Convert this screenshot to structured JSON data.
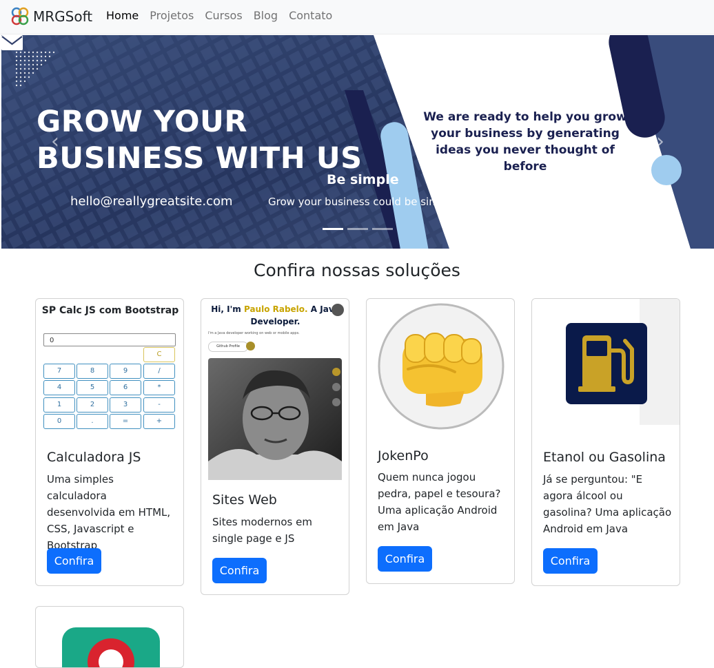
{
  "navbar": {
    "brand": "MRGSoft",
    "links": [
      {
        "label": "Home",
        "active": true
      },
      {
        "label": "Projetos",
        "active": false
      },
      {
        "label": "Cursos",
        "active": false
      },
      {
        "label": "Blog",
        "active": false
      },
      {
        "label": "Contato",
        "active": false
      }
    ]
  },
  "hero": {
    "title_line1": "GROW YOUR",
    "title_line2": "BUSINESS WITH US",
    "email": "hello@reallygreatsite.com",
    "right_text": "We are ready to help you grow your business by generating ideas you never thought of before",
    "caption_title": "Be simple",
    "caption_text": "Grow your business could be simple",
    "indicators": 3,
    "active_indicator": 1,
    "prev_icon": "chevron-left-icon",
    "next_icon": "chevron-right-icon",
    "colors": {
      "navy": "#1a2050",
      "light_blue": "#9fccef"
    }
  },
  "section": {
    "title": "Confira nossas soluções"
  },
  "cards": [
    {
      "title": "Calculadora JS",
      "text": "Uma simples calculadora desenvolvida em HTML, CSS, Javascript e Bootstrap",
      "button": "Confira",
      "preview": {
        "title": "SP Calc JS com Bootstrap",
        "display": "0",
        "clear": "C",
        "keys": [
          "7",
          "8",
          "9",
          "/",
          "4",
          "5",
          "6",
          "*",
          "1",
          "2",
          "3",
          "-",
          "0",
          ".",
          "=",
          "+"
        ]
      }
    },
    {
      "title": "Sites Web",
      "text": "Sites modernos em single page e JS",
      "button": "Confira",
      "preview": {
        "hi": "Hi, I'm ",
        "name": "Paulo Rabelo.",
        "role": " A Java Developer.",
        "subtitle": "I'm a Java developer working on web or mobile apps.",
        "pill": "Github Profile"
      }
    },
    {
      "title": "JokenPo",
      "text": "Quem nunca jogou pedra, papel e tesoura? Uma aplicação Android em Java",
      "button": "Confira",
      "preview": {
        "icon": "fist-emoji-icon"
      }
    },
    {
      "title": "Etanol ou Gasolina",
      "text": "Já se perguntou: \"E agora álcool ou gasolina? Uma aplicação Android em Java",
      "button": "Confira",
      "preview": {
        "icon": "fuel-pump-icon",
        "icon_bg": "#0a1a4a",
        "icon_color": "#c9a227"
      }
    },
    {
      "preview": {
        "icon": "app-icon",
        "icon_bg": "#1aa887",
        "accent": "#d9232e"
      }
    }
  ]
}
